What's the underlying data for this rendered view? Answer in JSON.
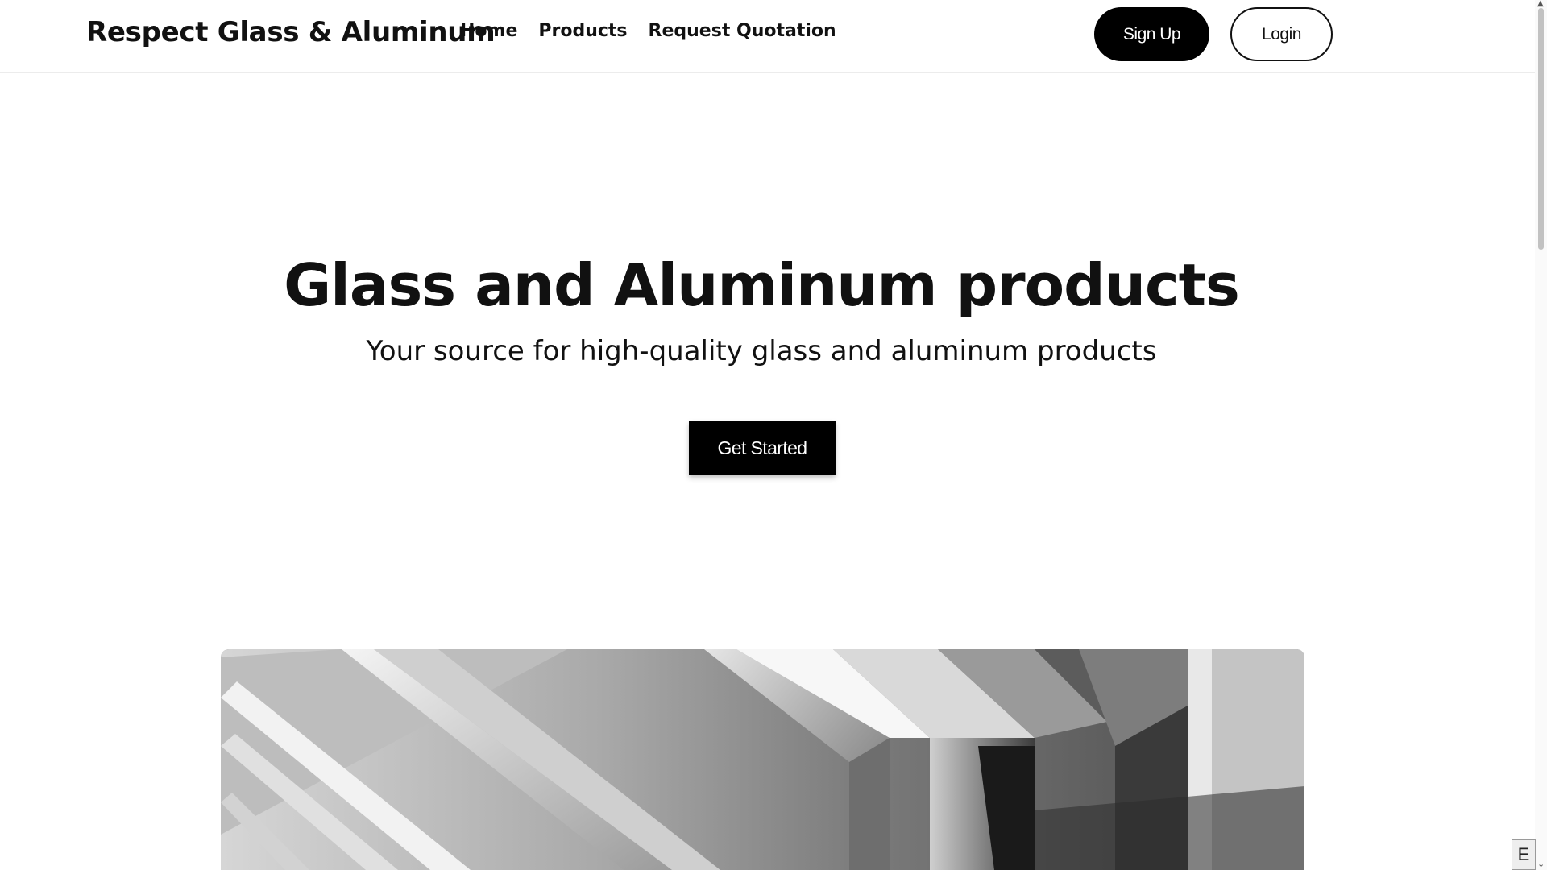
{
  "header": {
    "brand": "Respect Glass & Aluminum",
    "nav": [
      "Home",
      "Products",
      "Request Quotation"
    ],
    "signup_label": "Sign Up",
    "login_label": "Login"
  },
  "hero": {
    "title": "Glass and Aluminum products",
    "subtitle": "Your source for high-quality glass and aluminum products",
    "cta_label": "Get Started"
  },
  "corner_widget": {
    "label": "E"
  },
  "colors": {
    "primary": "#000000",
    "background": "#ffffff",
    "text": "#111111"
  }
}
